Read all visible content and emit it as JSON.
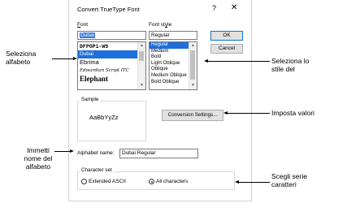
{
  "dialog": {
    "title": "Convert TrueType Font",
    "help_glyph": "?",
    "close_glyph": "✕"
  },
  "font": {
    "label_u": "F",
    "label_rest": "ont",
    "value": "Dubai",
    "items": [
      {
        "label": "DFPOP1-W9",
        "style": "bold-mono"
      },
      {
        "label": "Dubai",
        "style": "selected"
      },
      {
        "label": "Ebrima",
        "style": "normal"
      },
      {
        "label": "Edwardian Script ITC",
        "style": "script"
      },
      {
        "label": "Elephant",
        "style": "elephant"
      }
    ]
  },
  "style": {
    "label_pre": "Font st",
    "label_u": "y",
    "label_rest": "le",
    "value": "Regular",
    "items": [
      "Regular",
      "Medium",
      "Bold",
      "Light Oblique",
      "Oblique",
      "Medium Oblique",
      "Bold Oblique"
    ]
  },
  "buttons": {
    "ok": "OK",
    "cancel": "Cancel",
    "conversion_settings": "Conversion Settings..."
  },
  "sample": {
    "label": "Sample",
    "text": "AaBbYyZz"
  },
  "alphabet": {
    "label": "Alphabet name:",
    "value": "Dubai Regular"
  },
  "charset": {
    "label": "Character set",
    "options": [
      "Extended ASCII",
      "All characters"
    ],
    "selected": "All characters"
  },
  "annotations": {
    "select_alphabet": [
      "Seleziona",
      "alfabeto"
    ],
    "select_style": [
      "Seleziona lo",
      "stile del"
    ],
    "set_values": "Imposta valori",
    "enter_name": [
      "Immetti",
      "nome del",
      "alfabeto"
    ],
    "choose_charset": [
      "Scegli serie",
      "caratteri"
    ]
  },
  "colors": {
    "selection": "#1e6fd9",
    "accent_border": "#0078d7"
  }
}
